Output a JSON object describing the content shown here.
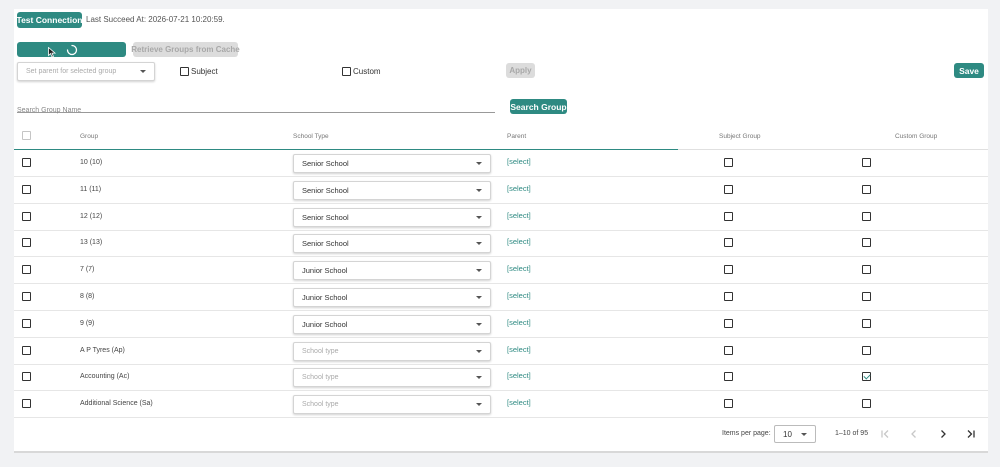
{
  "top": {
    "test_connection_label": "Test Connection",
    "last_succeed": "Last Succeed At: 2026-07-21 10:20:59.",
    "retrieve_label": "Retrieve Groups from Cache"
  },
  "controls": {
    "parent_placeholder": "Set parent for selected group",
    "subject_label": "Subject",
    "custom_label": "Custom",
    "apply_label": "Apply",
    "save_label": "Save",
    "search_placeholder": "Search Group Name",
    "search_button_label": "Search Group"
  },
  "table": {
    "headers": {
      "group": "Group",
      "school_type": "School Type",
      "parent": "Parent",
      "subject_group": "Subject Group",
      "custom_group": "Custom Group"
    },
    "rows": [
      {
        "group": "10 (10)",
        "school_type": "Senior School",
        "placeholder": false,
        "parent": "[select]",
        "subject": false,
        "custom": false
      },
      {
        "group": "11 (11)",
        "school_type": "Senior School",
        "placeholder": false,
        "parent": "[select]",
        "subject": false,
        "custom": false
      },
      {
        "group": "12 (12)",
        "school_type": "Senior School",
        "placeholder": false,
        "parent": "[select]",
        "subject": false,
        "custom": false
      },
      {
        "group": "13 (13)",
        "school_type": "Senior School",
        "placeholder": false,
        "parent": "[select]",
        "subject": false,
        "custom": false
      },
      {
        "group": "7 (7)",
        "school_type": "Junior School",
        "placeholder": false,
        "parent": "[select]",
        "subject": false,
        "custom": false
      },
      {
        "group": "8 (8)",
        "school_type": "Junior School",
        "placeholder": false,
        "parent": "[select]",
        "subject": false,
        "custom": false
      },
      {
        "group": "9 (9)",
        "school_type": "Junior School",
        "placeholder": false,
        "parent": "[select]",
        "subject": false,
        "custom": false
      },
      {
        "group": "A P Tyres (Ap)",
        "school_type": "School type",
        "placeholder": true,
        "parent": "[select]",
        "subject": false,
        "custom": false
      },
      {
        "group": "Accounting (Ac)",
        "school_type": "School type",
        "placeholder": true,
        "parent": "[select]",
        "subject": false,
        "custom": true
      },
      {
        "group": "Additional Science (Sa)",
        "school_type": "School type",
        "placeholder": true,
        "parent": "[select]",
        "subject": false,
        "custom": false
      }
    ]
  },
  "pager": {
    "items_per_page_label": "Items per page:",
    "items_per_page_value": "10",
    "range": "1–10 of 95",
    "first_icon": "first-page-icon",
    "prev_icon": "chevron-left-icon",
    "next_icon": "chevron-right-icon",
    "last_icon": "last-page-icon"
  },
  "colors": {
    "accent": "#2e8a82",
    "disabled": "#dcdcdc"
  }
}
